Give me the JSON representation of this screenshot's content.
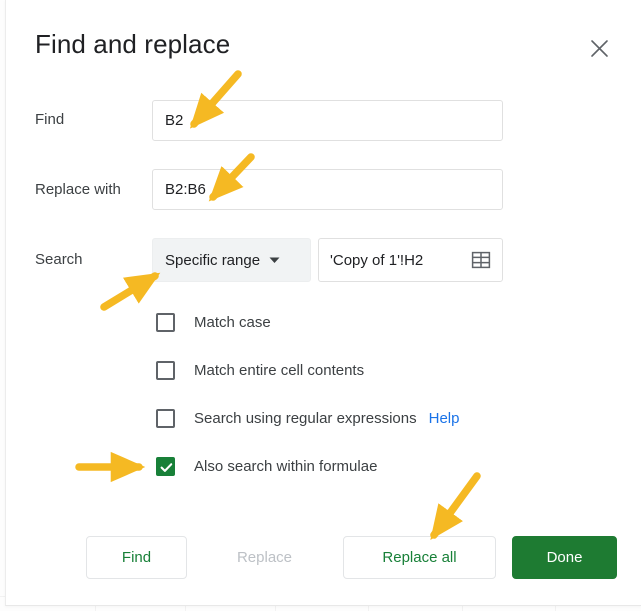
{
  "dialog": {
    "title": "Find and replace",
    "close_icon": "close-icon"
  },
  "fields": {
    "find": {
      "label": "Find",
      "value": "B2",
      "placeholder": ""
    },
    "replace": {
      "label": "Replace with",
      "value": "B2:B6",
      "placeholder": ""
    },
    "search": {
      "label": "Search",
      "scope_value": "Specific range",
      "scope_caret_icon": "chevron-down-icon",
      "range_value": "'Copy of 1'!H2",
      "range_picker_icon": "grid-select-icon"
    }
  },
  "options": [
    {
      "label": "Match case",
      "checked": false,
      "help": null
    },
    {
      "label": "Match entire cell contents",
      "checked": false,
      "help": null
    },
    {
      "label": "Search using regular expressions",
      "checked": false,
      "help": "Help"
    },
    {
      "label": "Also search within formulae",
      "checked": true,
      "help": null
    }
  ],
  "buttons": {
    "find": "Find",
    "replace": "Replace",
    "replace_all": "Replace all",
    "done": "Done"
  },
  "colors": {
    "accent_green": "#188038",
    "done_green": "#1e7b32",
    "link_blue": "#1a73e8",
    "annotation_yellow": "#f5b923",
    "text_primary": "#202124",
    "text_secondary": "#3c4043",
    "disabled_text": "#bdc1c6"
  },
  "annotations": [
    {
      "name": "arrow-to-find-input",
      "direction": "down-left"
    },
    {
      "name": "arrow-to-replace-input",
      "direction": "down-left"
    },
    {
      "name": "arrow-to-search-scope",
      "direction": "up-right"
    },
    {
      "name": "arrow-to-formulae-checkbox",
      "direction": "right"
    },
    {
      "name": "arrow-to-replace-all",
      "direction": "down-left"
    }
  ]
}
